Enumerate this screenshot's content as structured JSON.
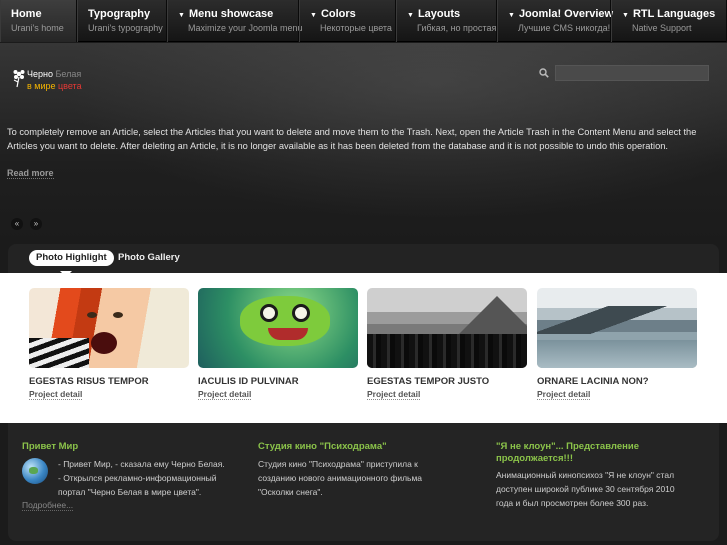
{
  "nav": [
    {
      "label": "Home",
      "sub": "Urani's home",
      "caret": false,
      "active": true
    },
    {
      "label": "Typography",
      "sub": "Urani's typography",
      "caret": false,
      "active": false
    },
    {
      "label": "Menu showcase",
      "sub": "Maximize your Joomla menu",
      "caret": true,
      "active": false
    },
    {
      "label": "Colors",
      "sub": "Некоторые цвета",
      "caret": true,
      "active": false
    },
    {
      "label": "Layouts",
      "sub": "Гибкая, но простая",
      "caret": true,
      "active": false
    },
    {
      "label": "Joomla! Overview",
      "sub": "Лучшие CMS никогда!",
      "caret": true,
      "active": false
    },
    {
      "label": "RTL Languages",
      "sub": "Native Support",
      "caret": true,
      "active": false
    }
  ],
  "logo": {
    "line1_a": "Черно",
    "line1_b": "Белая",
    "line2_a": "в мире ",
    "line2_b": "цвета"
  },
  "search": {
    "placeholder": "",
    "value": ""
  },
  "hero": {
    "intro": "To completely remove an Article, select the Articles that you want to delete and move them to the Trash. Next, open the Article Trash in the Content Menu and select the Articles you want to delete. After deleting an Article, it is no longer available as it has been deleted from the database and it is not possible to undo this operation.",
    "read_more": "Read more",
    "prev": "«",
    "next": "»"
  },
  "gallery": {
    "tabs": [
      "Photo Highlight",
      "Photo Gallery"
    ],
    "cards": [
      {
        "title": "EGESTAS RISUS TEMPOR",
        "link": "Project detail"
      },
      {
        "title": "IACULIS ID PULVINAR",
        "link": "Project detail"
      },
      {
        "title": "EGESTAS TEMPOR JUSTO",
        "link": "Project detail"
      },
      {
        "title": "ORNARE LACINIA NON?",
        "link": "Project detail"
      }
    ]
  },
  "footer": {
    "col1": {
      "title": "Привет Мир",
      "lines": [
        "- Привет Мир, - сказала ему Черно Белая.",
        "- Открылся рекламно-информационный",
        "портал  \"Черно Белая в мире цвета\"."
      ],
      "link": "Подробнее..."
    },
    "col2": {
      "title": "Студия кино \"Психодрама\"",
      "lines": [
        "Студия кино \"Психодрама\" приступила к",
        "созданию нового анимационного фильма",
        "\"Осколки снега\"."
      ]
    },
    "col3": {
      "title_lines": [
        "\"Я не клоун\"... Представление",
        "продолжается!!!"
      ],
      "lines": [
        "Анимационный кинопсихоз \"Я не клоун\" стал",
        "доступен широкой публике 30 сентября 2010",
        "года и был просмотрен более 300 раз."
      ]
    }
  },
  "colors": {
    "accent_green": "#8bc34a",
    "background": "#1b1b1b",
    "gallery_bg": "#ffffff"
  }
}
